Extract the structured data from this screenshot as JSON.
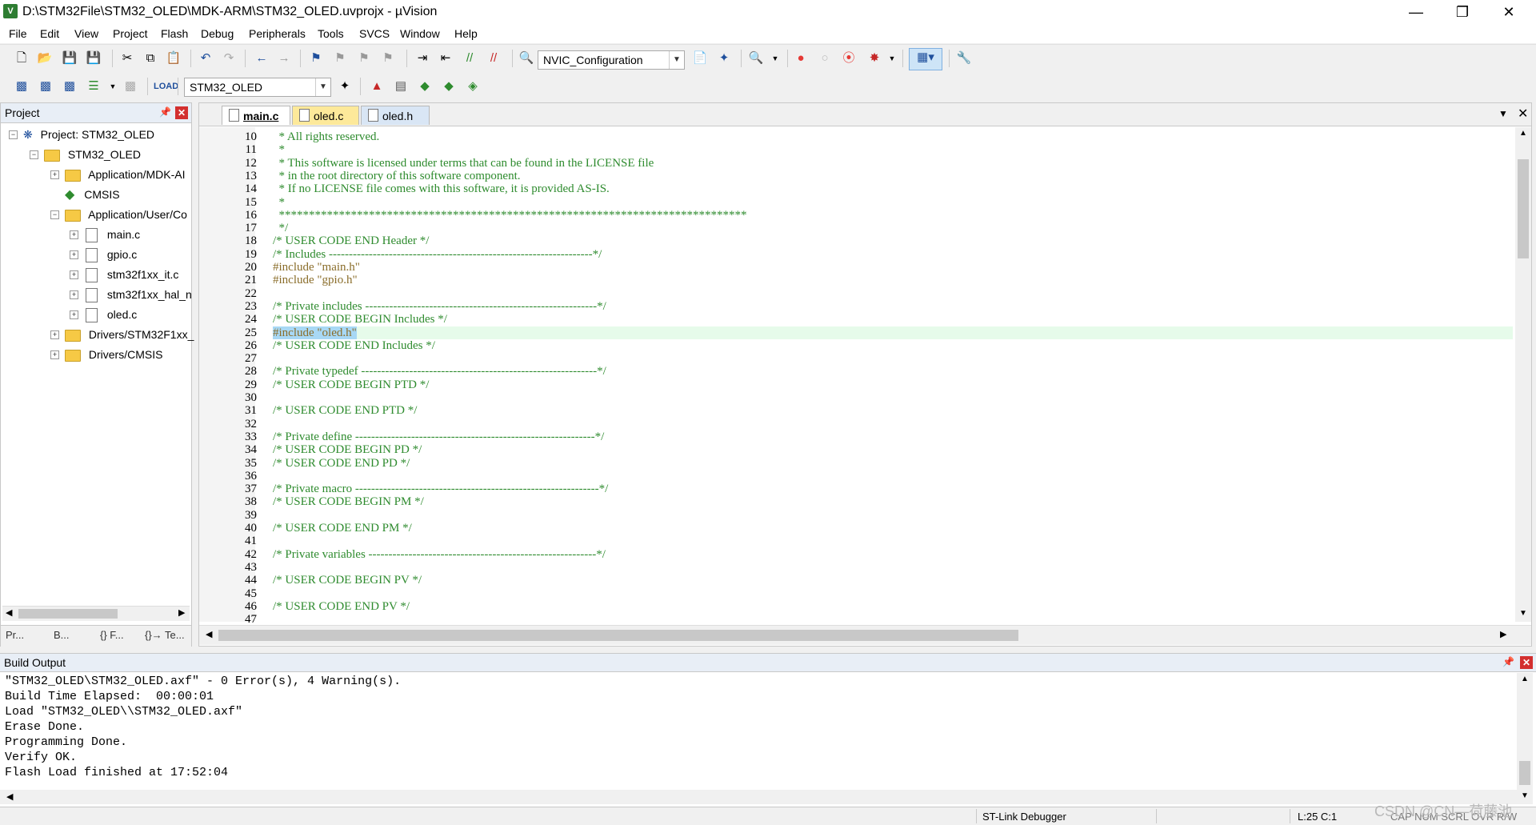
{
  "window": {
    "title": "D:\\STM32File\\STM32_OLED\\MDK-ARM\\STM32_OLED.uvprojx - µVision"
  },
  "menu": [
    "File",
    "Edit",
    "View",
    "Project",
    "Flash",
    "Debug",
    "Peripherals",
    "Tools",
    "SVCS",
    "Window",
    "Help"
  ],
  "toolbar": {
    "config_combo": "NVIC_Configuration",
    "target_combo": "STM32_OLED"
  },
  "project_panel": {
    "title": "Project",
    "tree": [
      {
        "label": "Project: STM32_OLED",
        "icon": "project-icon"
      },
      {
        "label": "STM32_OLED",
        "icon": "target-icon"
      },
      {
        "label": "Application/MDK-AI",
        "icon": "folder-icon"
      },
      {
        "label": "CMSIS",
        "icon": "diamond-icon"
      },
      {
        "label": "Application/User/Co",
        "icon": "folder-icon"
      },
      {
        "label": "main.c",
        "icon": "file-icon"
      },
      {
        "label": "gpio.c",
        "icon": "file-icon"
      },
      {
        "label": "stm32f1xx_it.c",
        "icon": "file-icon"
      },
      {
        "label": "stm32f1xx_hal_n",
        "icon": "file-icon"
      },
      {
        "label": "oled.c",
        "icon": "file-icon"
      },
      {
        "label": "Drivers/STM32F1xx_",
        "icon": "folder-icon"
      },
      {
        "label": "Drivers/CMSIS",
        "icon": "folder-icon"
      }
    ],
    "tabs": [
      "Pr...",
      "B...",
      "{} F...",
      "{}→ Te..."
    ]
  },
  "editor": {
    "tabs": [
      "main.c",
      "oled.c",
      "oled.h"
    ],
    "active_tab": "main.c",
    "lines": [
      {
        "n": "10",
        "t": "  * All rights reserved.",
        "k": "cm"
      },
      {
        "n": "11",
        "t": "  *",
        "k": "cm"
      },
      {
        "n": "12",
        "t": "  * This software is licensed under terms that can be found in the LICENSE file",
        "k": "cm"
      },
      {
        "n": "13",
        "t": "  * in the root directory of this software component.",
        "k": "cm"
      },
      {
        "n": "14",
        "t": "  * If no LICENSE file comes with this software, it is provided AS-IS.",
        "k": "cm"
      },
      {
        "n": "15",
        "t": "  *",
        "k": "cm"
      },
      {
        "n": "16",
        "t": "  ******************************************************************************",
        "k": "cm"
      },
      {
        "n": "17",
        "t": "  */",
        "k": "cm"
      },
      {
        "n": "18",
        "t": "/* USER CODE END Header */",
        "k": "cm"
      },
      {
        "n": "19",
        "t": "/* Includes ------------------------------------------------------------------*/",
        "k": "cm"
      },
      {
        "n": "20",
        "t": "#include \"main.h\"",
        "k": "pp"
      },
      {
        "n": "21",
        "t": "#include \"gpio.h\"",
        "k": "pp"
      },
      {
        "n": "22",
        "t": "",
        "k": "cm"
      },
      {
        "n": "23",
        "t": "/* Private includes ----------------------------------------------------------*/",
        "k": "cm"
      },
      {
        "n": "24",
        "t": "/* USER CODE BEGIN Includes */",
        "k": "cm"
      },
      {
        "n": "25",
        "t": "#include \"oled.h\"",
        "k": "sel"
      },
      {
        "n": "26",
        "t": "/* USER CODE END Includes */",
        "k": "cm"
      },
      {
        "n": "27",
        "t": "",
        "k": "cm"
      },
      {
        "n": "28",
        "t": "/* Private typedef -----------------------------------------------------------*/",
        "k": "cm"
      },
      {
        "n": "29",
        "t": "/* USER CODE BEGIN PTD */",
        "k": "cm"
      },
      {
        "n": "30",
        "t": "",
        "k": "cm"
      },
      {
        "n": "31",
        "t": "/* USER CODE END PTD */",
        "k": "cm"
      },
      {
        "n": "32",
        "t": "",
        "k": "cm"
      },
      {
        "n": "33",
        "t": "/* Private define ------------------------------------------------------------*/",
        "k": "cm"
      },
      {
        "n": "34",
        "t": "/* USER CODE BEGIN PD */",
        "k": "cm"
      },
      {
        "n": "35",
        "t": "/* USER CODE END PD */",
        "k": "cm"
      },
      {
        "n": "36",
        "t": "",
        "k": "cm"
      },
      {
        "n": "37",
        "t": "/* Private macro -------------------------------------------------------------*/",
        "k": "cm"
      },
      {
        "n": "38",
        "t": "/* USER CODE BEGIN PM */",
        "k": "cm"
      },
      {
        "n": "39",
        "t": "",
        "k": "cm"
      },
      {
        "n": "40",
        "t": "/* USER CODE END PM */",
        "k": "cm"
      },
      {
        "n": "41",
        "t": "",
        "k": "cm"
      },
      {
        "n": "42",
        "t": "/* Private variables ---------------------------------------------------------*/",
        "k": "cm"
      },
      {
        "n": "43",
        "t": "",
        "k": "cm"
      },
      {
        "n": "44",
        "t": "/* USER CODE BEGIN PV */",
        "k": "cm"
      },
      {
        "n": "45",
        "t": "",
        "k": "cm"
      },
      {
        "n": "46",
        "t": "/* USER CODE END PV */",
        "k": "cm"
      },
      {
        "n": "47",
        "t": "",
        "k": "cm"
      }
    ]
  },
  "build_output": {
    "title": "Build Output",
    "lines": [
      "\"STM32_OLED\\STM32_OLED.axf\" - 0 Error(s), 4 Warning(s).",
      "Build Time Elapsed:  00:00:01",
      "Load \"STM32_OLED\\\\STM32_OLED.axf\"",
      "Erase Done.",
      "Programming Done.",
      "Verify OK.",
      "Flash Load finished at 17:52:04"
    ]
  },
  "status": {
    "debugger": "ST-Link Debugger",
    "position": "L:25 C:1",
    "indicators": "CAP  NUM  SCRL  OVR  R/W",
    "watermark": "CSDN @CN—荷藤池"
  }
}
